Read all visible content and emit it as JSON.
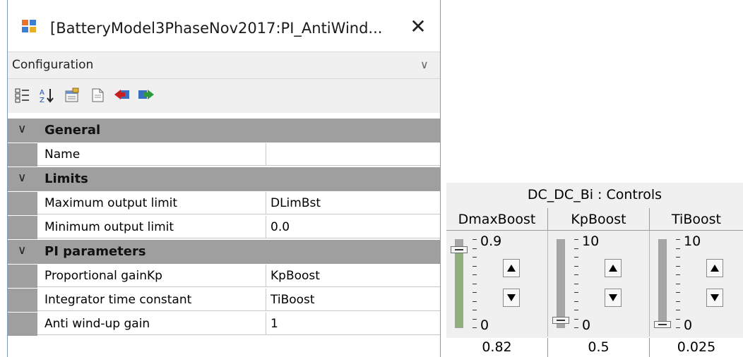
{
  "window": {
    "title": "[BatteryModel3PhaseNov2017:PI_AntiWind...",
    "close_glyph": "✕",
    "config_label": "Configuration",
    "config_chevron": "∨"
  },
  "toolbar": {
    "icons": [
      "categorized-icon",
      "alphabetical-sort-icon",
      "property-pages-icon",
      "new-document-icon",
      "back-arrow-icon",
      "forward-arrow-icon"
    ]
  },
  "categories": [
    {
      "label": "General",
      "chevron": "∨",
      "rows": [
        {
          "name": "Name",
          "value": ""
        }
      ]
    },
    {
      "label": "Limits",
      "chevron": "∨",
      "rows": [
        {
          "name": "Maximum output limit",
          "value": "DLimBst"
        },
        {
          "name": "Minimum output limit",
          "value": "0.0"
        }
      ]
    },
    {
      "label": "PI parameters",
      "chevron": "∨",
      "rows": [
        {
          "name": "Proportional gainKp",
          "value": "KpBoost"
        },
        {
          "name": "Integrator time constant",
          "value": "TiBoost"
        },
        {
          "name": "Anti wind-up gain",
          "value": "1"
        }
      ]
    }
  ],
  "controls": {
    "title": "DC_DC_Bi : Controls",
    "sliders": [
      {
        "label": "DmaxBoost",
        "max_label": "0.9",
        "min_label": "0",
        "value": "0.82",
        "level": 0.911,
        "filled": true
      },
      {
        "label": "KpBoost",
        "max_label": "10",
        "min_label": "0",
        "value": "0.5",
        "level": 0.05,
        "filled": false
      },
      {
        "label": "TiBoost",
        "max_label": "10",
        "min_label": "0",
        "value": "0.025",
        "level": 0.0025,
        "filled": false
      }
    ]
  },
  "colors": {
    "category_band": "#9f9f9f",
    "slider_fill": "#8fb07a",
    "slider_track": "#a6a6a6",
    "panel_bg": "#f0f0f0"
  }
}
